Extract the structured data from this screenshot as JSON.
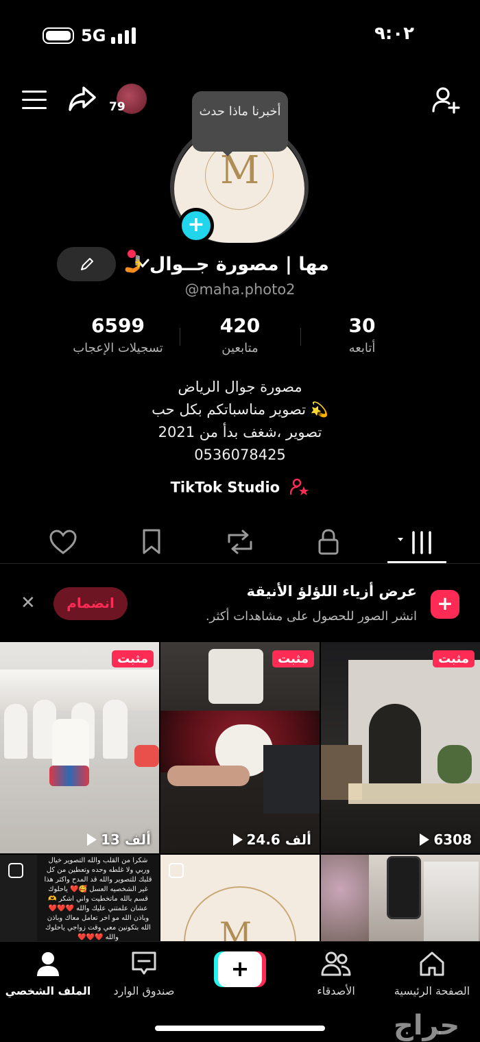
{
  "status_bar": {
    "time": "٩:٠٢",
    "network": "5G"
  },
  "top_bar": {
    "notification_count": "79"
  },
  "profile": {
    "tooltip": "أخبرنا ماذا حدث",
    "name": "مها | مصورة جــوال",
    "name_emoji": "🤳",
    "handle": "@maha.photo2",
    "stats": [
      {
        "value": "6599",
        "label": "تسجيلات الإعجاب"
      },
      {
        "value": "420",
        "label": "متابعين"
      },
      {
        "value": "30",
        "label": "أتابعه"
      }
    ],
    "bio": [
      "مصورة جوال الرياض",
      "تصوير مناسباتكم بكل حب 💫",
      "تصوير ،شغف بدأ من 2021",
      "0536078425"
    ],
    "studio_link": "TikTok Studio"
  },
  "promo": {
    "title": "عرض أزياء اللؤلؤ الأنيقة",
    "subtitle": "انشر الصور للحصول على مشاهدات أكثر.",
    "join_label": "انضمام"
  },
  "grid": {
    "pinned_label": "مثبت",
    "items": [
      {
        "views": "13 ألف"
      },
      {
        "views": "24.6 ألف"
      },
      {
        "views": "6308"
      }
    ],
    "note_text": "شكرا من القلب والله التصوير خيال وربي ولا غلطه وحده وتعطين من كل قلبك للتصوير والله قد المدح واكثر هذا غير الشخصيه العسل 🥰❤️ ياحلوك قسم بالله ماتخطيت واني اشكر 🫶 عشان علمتني عليك والله ❤️❤️❤️ وباذن الله مو اخر تعامل معاك وباذن الله بتكونين معي وقت زواجي ياحلوك والله ❤️❤️❤️"
  },
  "bottom_nav": {
    "items": [
      {
        "label": "الملف الشخصي"
      },
      {
        "label": "صندوق الوارد"
      },
      {
        "label": "الأصدقاء"
      },
      {
        "label": "الصفحة الرئيسية"
      }
    ]
  },
  "watermark": "حراج",
  "colors": {
    "accent": "#fe2c55",
    "cyan": "#25f4ee",
    "background": "#000000"
  }
}
